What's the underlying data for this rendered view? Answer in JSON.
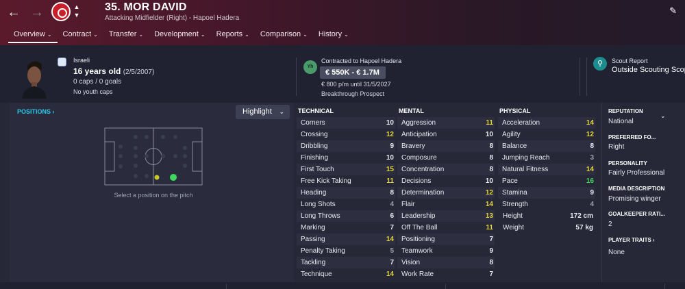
{
  "header": {
    "player_name": "35. MOR DAVID",
    "role_club": "Attacking Midfielder (Right) - Hapoel Hadera",
    "tabs": [
      {
        "label": "Overview"
      },
      {
        "label": "Contract"
      },
      {
        "label": "Transfer"
      },
      {
        "label": "Development"
      },
      {
        "label": "Reports"
      },
      {
        "label": "Comparison"
      },
      {
        "label": "History"
      }
    ]
  },
  "profile": {
    "nationality": "Israeli",
    "age": "16 years old",
    "dob": "(2/5/2007)",
    "caps": "0 caps / 0 goals",
    "youth_caps": "No youth caps"
  },
  "contract": {
    "badge": "Yh",
    "contracted_to": "Contracted to Hapoel Hadera",
    "value": "€ 550K - € 1.7M",
    "wage": "€ 800 p/m until 31/5/2027",
    "prospect": "Breakthrough Prospect"
  },
  "scout": {
    "title": "Scout Report",
    "value": "Outside Scouting Scope"
  },
  "positions": {
    "label": "POSITIONS ›",
    "highlight_button": "Highlight",
    "caption": "Select a position on the pitch"
  },
  "technical": {
    "title": "TECHNICAL",
    "attrs": [
      {
        "name": "Corners",
        "value": "10"
      },
      {
        "name": "Crossing",
        "value": "12"
      },
      {
        "name": "Dribbling",
        "value": "9"
      },
      {
        "name": "Finishing",
        "value": "10"
      },
      {
        "name": "First Touch",
        "value": "15"
      },
      {
        "name": "Free Kick Taking",
        "value": "11"
      },
      {
        "name": "Heading",
        "value": "8"
      },
      {
        "name": "Long Shots",
        "value": "4"
      },
      {
        "name": "Long Throws",
        "value": "6"
      },
      {
        "name": "Marking",
        "value": "7"
      },
      {
        "name": "Passing",
        "value": "14"
      },
      {
        "name": "Penalty Taking",
        "value": "5"
      },
      {
        "name": "Tackling",
        "value": "7"
      },
      {
        "name": "Technique",
        "value": "14"
      }
    ]
  },
  "mental": {
    "title": "MENTAL",
    "attrs": [
      {
        "name": "Aggression",
        "value": "11"
      },
      {
        "name": "Anticipation",
        "value": "10"
      },
      {
        "name": "Bravery",
        "value": "8"
      },
      {
        "name": "Composure",
        "value": "8"
      },
      {
        "name": "Concentration",
        "value": "8"
      },
      {
        "name": "Decisions",
        "value": "10"
      },
      {
        "name": "Determination",
        "value": "12"
      },
      {
        "name": "Flair",
        "value": "14"
      },
      {
        "name": "Leadership",
        "value": "13"
      },
      {
        "name": "Off The Ball",
        "value": "11"
      },
      {
        "name": "Positioning",
        "value": "7"
      },
      {
        "name": "Teamwork",
        "value": "9"
      },
      {
        "name": "Vision",
        "value": "8"
      },
      {
        "name": "Work Rate",
        "value": "7"
      }
    ]
  },
  "physical": {
    "title": "PHYSICAL",
    "attrs": [
      {
        "name": "Acceleration",
        "value": "14"
      },
      {
        "name": "Agility",
        "value": "12"
      },
      {
        "name": "Balance",
        "value": "8"
      },
      {
        "name": "Jumping Reach",
        "value": "3"
      },
      {
        "name": "Natural Fitness",
        "value": "14"
      },
      {
        "name": "Pace",
        "value": "16"
      },
      {
        "name": "Stamina",
        "value": "9"
      },
      {
        "name": "Strength",
        "value": "4"
      }
    ],
    "height_label": "Height",
    "height": "172 cm",
    "weight_label": "Weight",
    "weight": "57 kg"
  },
  "side": {
    "reputation_title": "REPUTATION",
    "reputation": "National",
    "foot_title": "PREFERRED FO...",
    "foot": "Right",
    "personality_title": "PERSONALITY",
    "personality": "Fairly Professional",
    "media_title": "MEDIA DESCRIPTION",
    "media": "Promising winger",
    "gk_title": "GOALKEEPER RATI...",
    "gk": "2",
    "traits_title": "PLAYER TRAITS ›",
    "traits": "None"
  },
  "colors": {
    "accent_cyan": "#2ec8e8",
    "value_yellow": "#e2d43a",
    "value_green": "#3ed85c"
  }
}
